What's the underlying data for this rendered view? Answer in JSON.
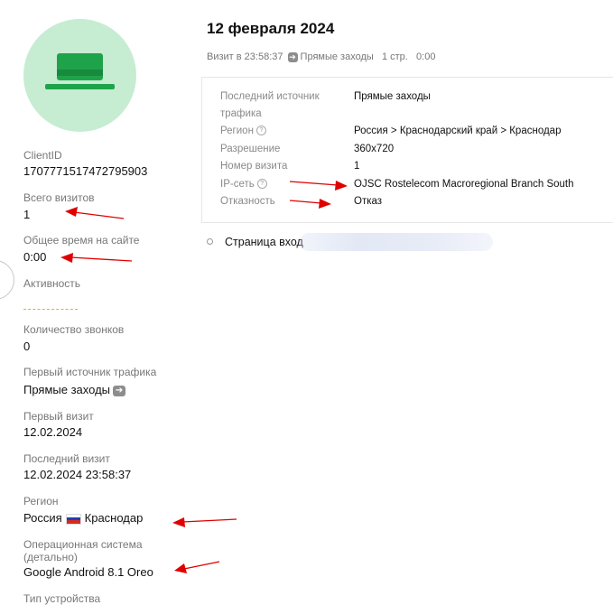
{
  "profile": {
    "avatar_icon": "hat-icon",
    "fields": [
      {
        "label": "ClientID",
        "value": "1707771517472795903"
      },
      {
        "label": "Всего визитов",
        "value": "1"
      },
      {
        "label": "Общее время на сайте",
        "value": "0:00"
      },
      {
        "label": "Активность",
        "value": ""
      },
      {
        "label": "Количество звонков",
        "value": "0"
      },
      {
        "label": "Первый источник трафика",
        "value": "Прямые заходы"
      },
      {
        "label": "Первый визит",
        "value": "12.02.2024"
      },
      {
        "label": "Последний визит",
        "value": "12.02.2024 23:58:37"
      },
      {
        "label": "Регион",
        "value_country": "Россия",
        "value_city": "Краснодар"
      },
      {
        "label_line1": "Операционная система",
        "label_line2": "(детально)",
        "value": "Google Android 8.1 Oreo"
      },
      {
        "label": "Тип устройства"
      }
    ]
  },
  "visit": {
    "date_title": "12 февраля 2024",
    "time_prefix": "Визит в 23:58:37",
    "source": "Прямые заходы",
    "pages": "1 стр.",
    "duration": "0:00",
    "details": [
      {
        "key_line1": "Последний источник",
        "key_line2": "трафика",
        "value": "Прямые заходы"
      },
      {
        "key": "Регион",
        "value": "Россия > Краснодарский край > Краснодар"
      },
      {
        "key": "Разрешение",
        "value": "360x720"
      },
      {
        "key": "Номер визита",
        "value": "1"
      },
      {
        "key": "IP-сеть",
        "value": "OJSC Rostelecom Macroregional Branch South"
      },
      {
        "key": "Отказность",
        "value": "Отказ"
      }
    ],
    "page_entry_label": "Страница вход"
  },
  "colors": {
    "avatar_bg": "#c6ecd2",
    "hat": "#1fa34a",
    "annotation_arrow": "#e00000"
  }
}
